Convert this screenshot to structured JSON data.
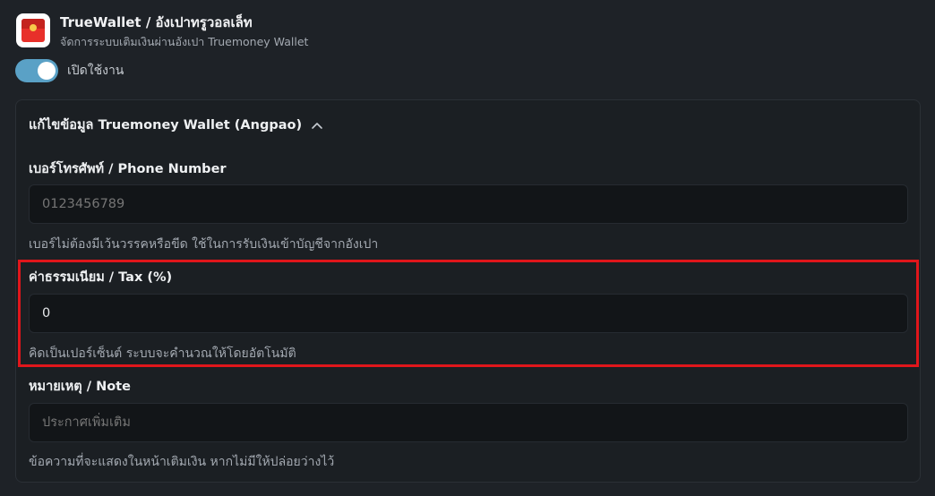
{
  "app": {
    "title": "TrueWallet / อังเปาทรูวอลเล็ท",
    "subtitle": "จัดการระบบเติมเงินผ่านอังเปา Truemoney Wallet",
    "icon": "red-envelope-icon"
  },
  "toggle": {
    "label": "เปิดใช้งาน",
    "checked": true,
    "color": "#5aa1c6"
  },
  "section": {
    "title": "แก้ไขข้อมูล Truemoney Wallet (Angpao)",
    "expanded": true
  },
  "fields": {
    "phone": {
      "label": "เบอร์โทรศัพท์ / Phone Number",
      "placeholder": "0123456789",
      "value": "",
      "help": "เบอร์ไม่ต้องมีเว้นวรรคหรือขีด ใช้ในการรับเงินเข้าบัญชีจากอังเปา"
    },
    "tax": {
      "label": "ค่าธรรมเนียม / Tax (%)",
      "value": "0",
      "help": "คิดเป็นเปอร์เซ็นต์ ระบบจะคำนวณให้โดยอัตโนมัติ"
    },
    "note": {
      "label": "หมายเหตุ / Note",
      "placeholder": "ประกาศเพิ่มเติม",
      "value": "",
      "help": "ข้อความที่จะแสดงในหน้าเติมเงิน หากไม่มีให้ปล่อยว่างไว้"
    }
  },
  "colors": {
    "background": "#1e2227",
    "highlight": "#e0161b"
  }
}
